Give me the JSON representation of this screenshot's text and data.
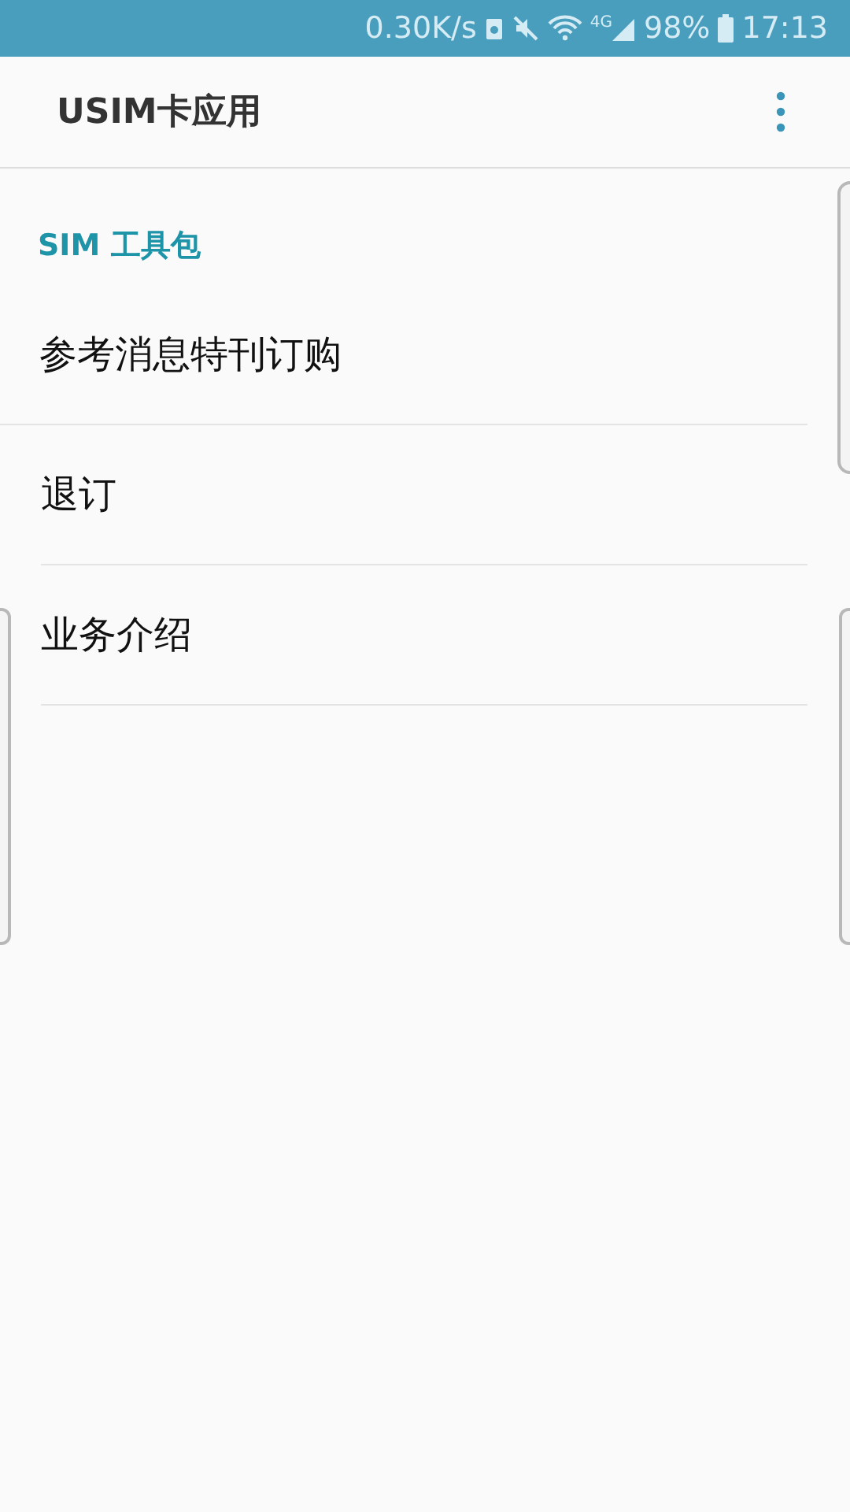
{
  "status_bar": {
    "speed": "0.30K/s",
    "network": "4G",
    "battery": "98%",
    "time": "17:13"
  },
  "app_bar": {
    "title": "USIM卡应用"
  },
  "section": {
    "title": "SIM 工具包"
  },
  "items": [
    {
      "label": "参考消息特刊订购"
    },
    {
      "label": "退订"
    },
    {
      "label": "业务介绍"
    }
  ]
}
